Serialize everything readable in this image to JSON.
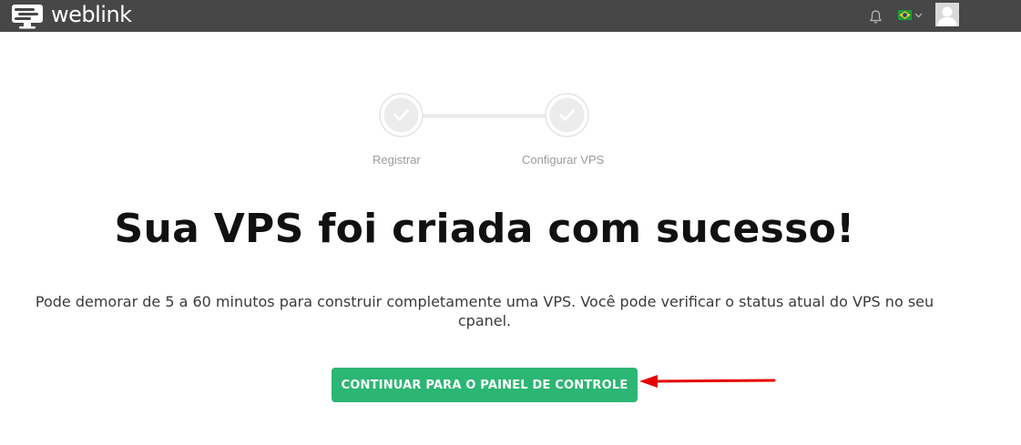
{
  "header": {
    "brand": "weblink",
    "icons": [
      "notification-bell-icon",
      "brazil-flag-icon",
      "chevron-down-icon",
      "user-avatar-icon"
    ]
  },
  "steps": [
    {
      "label": "Registrar",
      "state": "complete"
    },
    {
      "label": "Configurar VPS",
      "state": "complete"
    }
  ],
  "main": {
    "title": "Sua VPS foi criada com sucesso!",
    "description": "Pode demorar de 5 a 60 minutos para construir completamente uma VPS. Você pode verificar o status atual do VPS no seu cpanel.",
    "cta_label": "CONTINUAR PARA O PAINEL DE CONTROLE"
  },
  "colors": {
    "topbar": "#474747",
    "accent": "#2bb673",
    "annotation_arrow": "#e50000"
  }
}
